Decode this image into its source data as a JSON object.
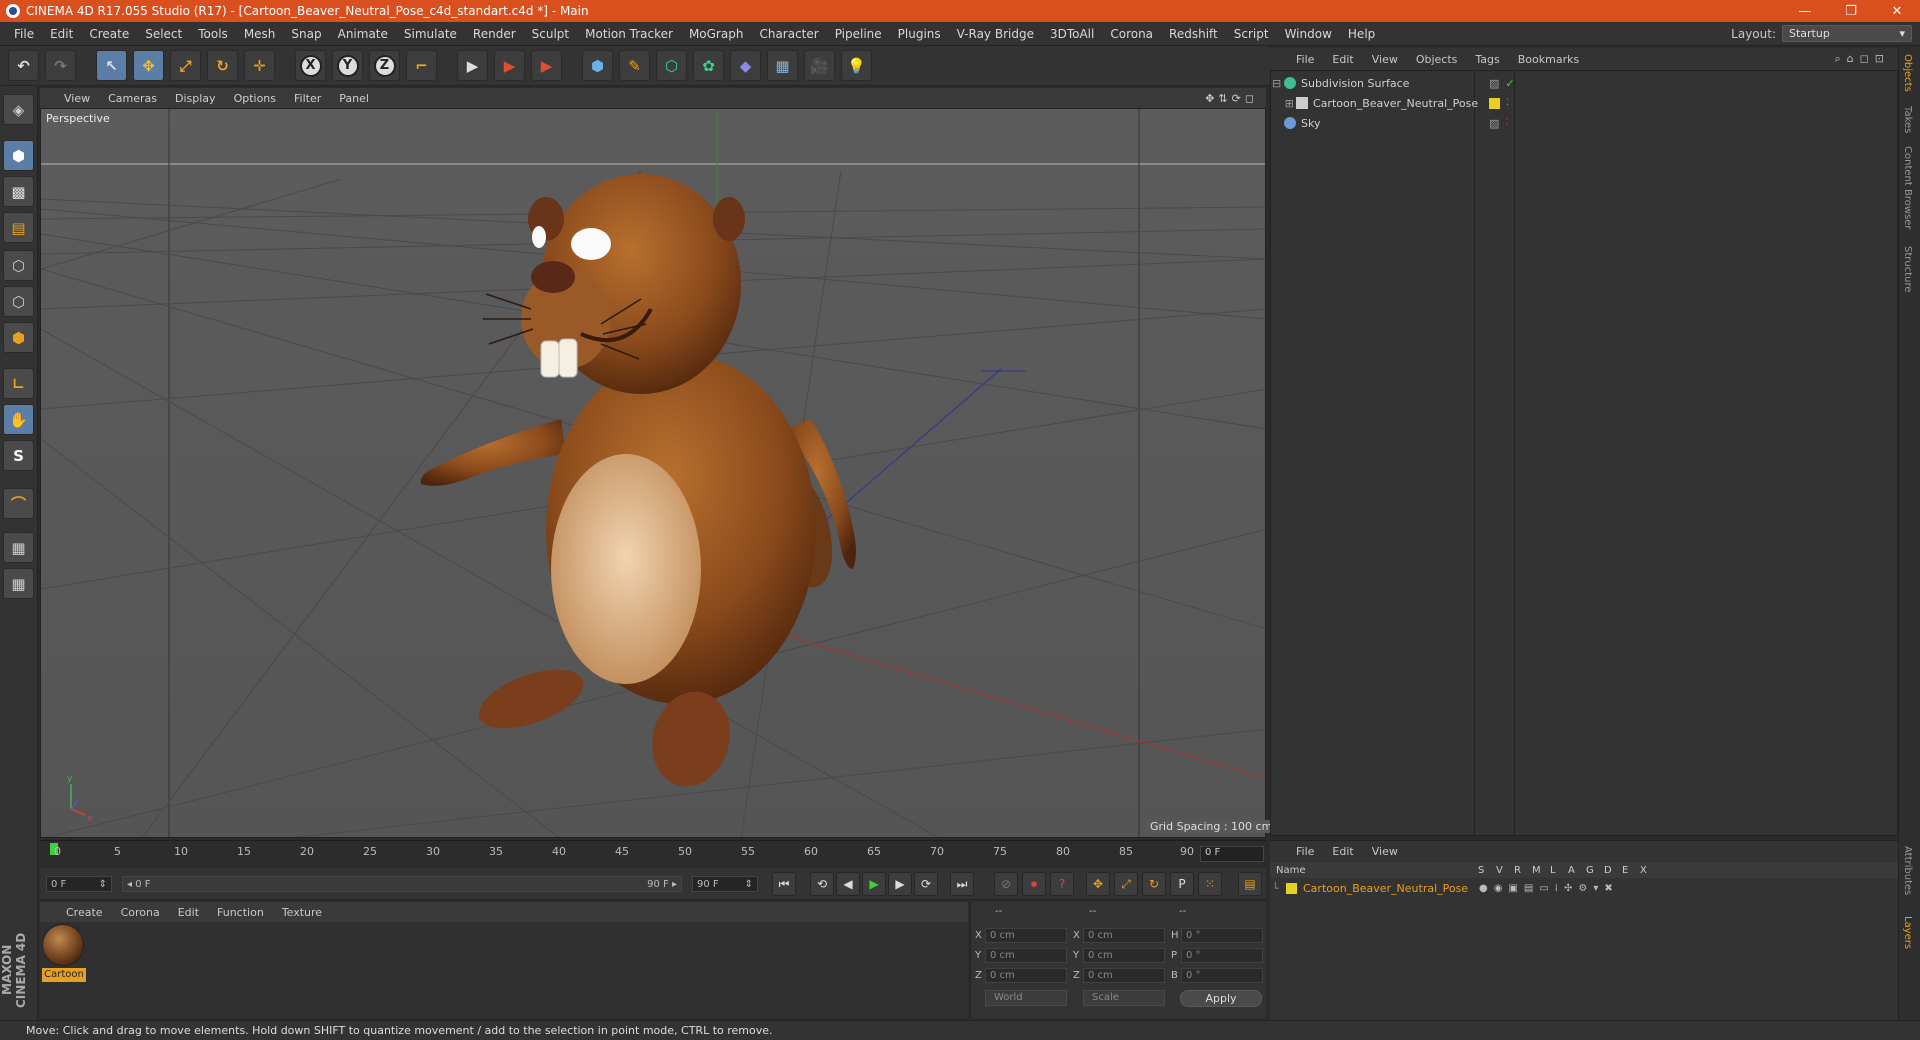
{
  "window": {
    "title": "CINEMA 4D R17.055 Studio (R17) - [Cartoon_Beaver_Neutral_Pose_c4d_standart.c4d *] - Main",
    "minimize": "—",
    "restore": "❐",
    "close": "✕"
  },
  "menubar": {
    "items": [
      "File",
      "Edit",
      "Create",
      "Select",
      "Tools",
      "Mesh",
      "Snap",
      "Animate",
      "Simulate",
      "Render",
      "Sculpt",
      "Motion Tracker",
      "MoGraph",
      "Character",
      "Pipeline",
      "Plugins",
      "V-Ray Bridge",
      "3DToAll",
      "Corona",
      "Redshift",
      "Script",
      "Window",
      "Help"
    ],
    "layout_label": "Layout:",
    "layout_value": "Startup"
  },
  "toolbar": {
    "undo": "↶",
    "redo": "↷",
    "live_select": "↖",
    "move": "✥",
    "scale": "⤢",
    "rotate": "↻",
    "transform": "✛",
    "axis_x": "X",
    "axis_y": "Y",
    "axis_z": "Z",
    "coord_system": "⌐",
    "render_view": "▶",
    "render_pic": "▶",
    "render_settings": "▶",
    "cube": "⬢",
    "pen": "✎",
    "subdiv": "⬡",
    "cloner": "✿",
    "deformer": "◆",
    "floor": "▦",
    "camera": "🎥",
    "light": "💡"
  },
  "viewport": {
    "menu": [
      "View",
      "Cameras",
      "Display",
      "Options",
      "Filter",
      "Panel"
    ],
    "nav_icons": "✥⇅⟳◻",
    "label": "Perspective",
    "grid_spacing": "Grid Spacing : 100 cm",
    "axis_y": "y",
    "axis_x": "x"
  },
  "timeline": {
    "ticks": [
      "0",
      "5",
      "10",
      "15",
      "20",
      "25",
      "30",
      "35",
      "40",
      "45",
      "50",
      "55",
      "60",
      "65",
      "70",
      "75",
      "80",
      "85",
      "90"
    ],
    "current_frame": "0 F",
    "start_field": "0 F",
    "slider_start": "◂ 0 F",
    "slider_end": "90 F ▸",
    "end_field": "90 F"
  },
  "transport": {
    "first": "⏮",
    "prev_key": "⟲",
    "prev": "◀",
    "play": "▶",
    "next": "▶",
    "next_key": "⟳",
    "last": "⏭",
    "key_mode": "⊘",
    "record": "⏺",
    "auto_key": "?",
    "pos_key": "✥",
    "scale_key": "⤢",
    "rot_key": "↻",
    "param_key": "P",
    "pla_key": "⁙",
    "timeline_btn": "▤"
  },
  "materials": {
    "menu": [
      "Create",
      "Corona",
      "Edit",
      "Function",
      "Texture"
    ],
    "items": [
      {
        "label": "Cartoon"
      }
    ]
  },
  "coordinates": {
    "header": [
      "--",
      "--",
      "--"
    ],
    "rows": [
      {
        "l1": "X",
        "v1": "0 cm",
        "l2": "X",
        "v2": "0 cm",
        "l3": "H",
        "v3": "0 °"
      },
      {
        "l1": "Y",
        "v1": "0 cm",
        "l2": "Y",
        "v2": "0 cm",
        "l3": "P",
        "v3": "0 °"
      },
      {
        "l1": "Z",
        "v1": "0 cm",
        "l2": "Z",
        "v2": "0 cm",
        "l3": "B",
        "v3": "0 °"
      }
    ],
    "mode": "World",
    "type": "Scale",
    "apply": "Apply"
  },
  "status": "Move: Click and drag to move elements. Hold down SHIFT to quantize movement / add to the selection in point mode, CTRL to remove.",
  "objects": {
    "menu": [
      "File",
      "Edit",
      "View",
      "Objects",
      "Tags",
      "Bookmarks"
    ],
    "tools": "⌕⌂◻⊡",
    "items": [
      {
        "name": "Subdivision Surface",
        "icon_color": "#3fbf8f"
      },
      {
        "name": "Cartoon_Beaver_Neutral_Pose",
        "icon_color": "#cccccc"
      },
      {
        "name": "Sky",
        "icon_color": "#6a9ad8"
      }
    ],
    "check": "✓"
  },
  "right_tabs": [
    "Objects",
    "Takes",
    "Content Browser",
    "Structure",
    "Attributes",
    "Layers"
  ],
  "maxon": "MAXON CINEMA 4D",
  "layers": {
    "menu": [
      "File",
      "Edit",
      "View"
    ],
    "columns": [
      "Name",
      "S",
      "V",
      "R",
      "M",
      "L",
      "A",
      "G",
      "D",
      "E",
      "X"
    ],
    "rows": [
      {
        "name": "Cartoon_Beaver_Neutral_Pose",
        "color": "#e8d020"
      }
    ]
  },
  "colors": {
    "accent": "#e8a020",
    "title_bar": "#d94f1e",
    "selection": "#5b7ea6"
  }
}
